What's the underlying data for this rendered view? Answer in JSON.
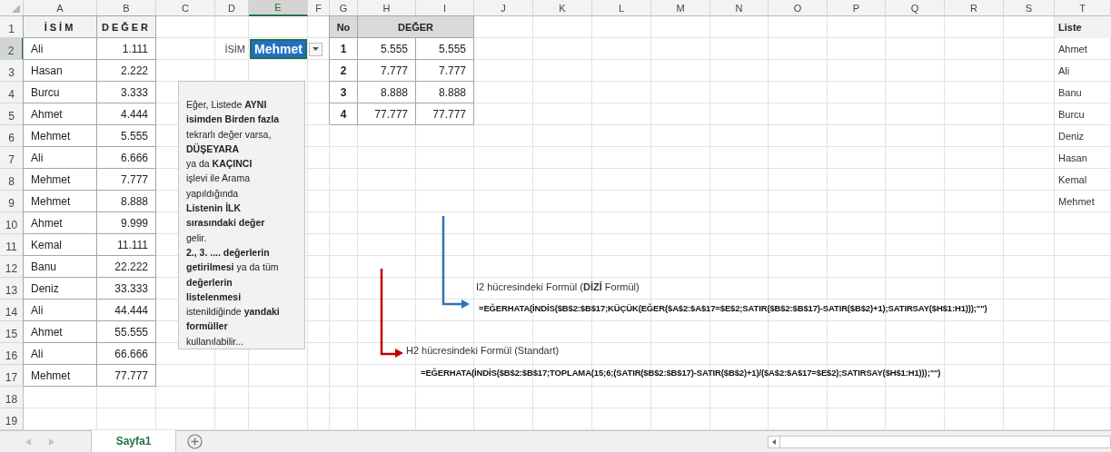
{
  "columns": [
    {
      "label": "A",
      "selected": false
    },
    {
      "label": "B",
      "selected": false
    },
    {
      "label": "C",
      "selected": false
    },
    {
      "label": "D",
      "selected": false
    },
    {
      "label": "E",
      "selected": true
    },
    {
      "label": "F",
      "selected": false
    },
    {
      "label": "G",
      "selected": false
    },
    {
      "label": "H",
      "selected": false
    },
    {
      "label": "I",
      "selected": false
    },
    {
      "label": "J",
      "selected": false
    },
    {
      "label": "K",
      "selected": false
    },
    {
      "label": "L",
      "selected": false
    },
    {
      "label": "M",
      "selected": false
    },
    {
      "label": "N",
      "selected": false
    },
    {
      "label": "O",
      "selected": false
    },
    {
      "label": "P",
      "selected": false
    },
    {
      "label": "Q",
      "selected": false
    },
    {
      "label": "R",
      "selected": false
    },
    {
      "label": "S",
      "selected": false
    },
    {
      "label": "T",
      "selected": false
    }
  ],
  "rows": [
    {
      "label": "1",
      "selected": false
    },
    {
      "label": "2",
      "selected": true
    },
    {
      "label": "3",
      "selected": false
    },
    {
      "label": "4",
      "selected": false
    },
    {
      "label": "5",
      "selected": false
    },
    {
      "label": "6",
      "selected": false
    },
    {
      "label": "7",
      "selected": false
    },
    {
      "label": "8",
      "selected": false
    },
    {
      "label": "9",
      "selected": false
    },
    {
      "label": "10",
      "selected": false
    },
    {
      "label": "11",
      "selected": false
    },
    {
      "label": "12",
      "selected": false
    },
    {
      "label": "13",
      "selected": false
    },
    {
      "label": "14",
      "selected": false
    },
    {
      "label": "15",
      "selected": false
    },
    {
      "label": "16",
      "selected": false
    },
    {
      "label": "17",
      "selected": false
    },
    {
      "label": "18",
      "selected": false
    },
    {
      "label": "19",
      "selected": false
    }
  ],
  "names_table": {
    "headers": [
      "İSİM",
      "DEĞER"
    ],
    "rows": [
      [
        "Ali",
        "1.111"
      ],
      [
        "Hasan",
        "2.222"
      ],
      [
        "Burcu",
        "3.333"
      ],
      [
        "Ahmet",
        "4.444"
      ],
      [
        "Mehmet",
        "5.555"
      ],
      [
        "Ali",
        "6.666"
      ],
      [
        "Mehmet",
        "7.777"
      ],
      [
        "Mehmet",
        "8.888"
      ],
      [
        "Ahmet",
        "9.999"
      ],
      [
        "Kemal",
        "11.111"
      ],
      [
        "Banu",
        "22.222"
      ],
      [
        "Deniz",
        "33.333"
      ],
      [
        "Ali",
        "44.444"
      ],
      [
        "Ahmet",
        "55.555"
      ],
      [
        "Ali",
        "66.666"
      ],
      [
        "Mehmet",
        "77.777"
      ]
    ]
  },
  "lookup": {
    "label": "İSİM",
    "value": "Mehmet",
    "selected": true
  },
  "results_table": {
    "headers": [
      "No",
      "DEĞER"
    ],
    "rows": [
      [
        "1",
        "5.555",
        "5.555"
      ],
      [
        "2",
        "7.777",
        "7.777"
      ],
      [
        "3",
        "8.888",
        "8.888"
      ],
      [
        "4",
        "77.777",
        "77.777"
      ]
    ]
  },
  "list": {
    "header": "Liste",
    "items": [
      "Ahmet",
      "Ali",
      "Banu",
      "Burcu",
      "Deniz",
      "Hasan",
      "Kemal",
      "Mehmet"
    ]
  },
  "note": {
    "lines": [
      "Eğer, Listede **AYNI**",
      "**isimden Birden fazla**",
      "tekrarlı değer varsa,",
      "**DÜŞEYARA**",
      "ya da **KAÇINCI**",
      "işlevi ile Arama",
      "yapıldığında",
      "**Listenin İLK**",
      "**sırasındaki değer**",
      "gelir.",
      "**2., 3. .... değerlerin**",
      "**getirilmesi** ya da tüm",
      "**değerlerin**",
      "**listelenmesi**",
      "istenildiğinde **yandaki**",
      "**formüller**",
      "kullanılabilir..."
    ]
  },
  "formulas": [
    {
      "kind": "array",
      "color": "#2e75b6",
      "label": "I2 hücresindeki Formül (**DİZİ** Formül)",
      "formula": "=EĞERHATA(İNDİS($B$2:$B$17;KÜÇÜK(EĞER($A$2:$A$17=$E$2;SATIR($B$2:$B$17)-SATIR($B$2)+1);SATIRSAY($H$1:H1)));\"\")"
    },
    {
      "kind": "standard",
      "color": "#c00000",
      "label": "H2 hücresindeki Formül (Standart)",
      "formula": "=EĞERHATA(İNDİS($B$2:$B$17;TOPLAMA(15;6;(SATIR($B$2:$B$17)-SATIR($B$2)+1)/($A$2:$A$17=$E$2);SATIRSAY($H$1:H1)));\"\")"
    }
  ],
  "sheet_tabs": [
    {
      "label": "Sayfa1",
      "selected": true
    }
  ]
}
